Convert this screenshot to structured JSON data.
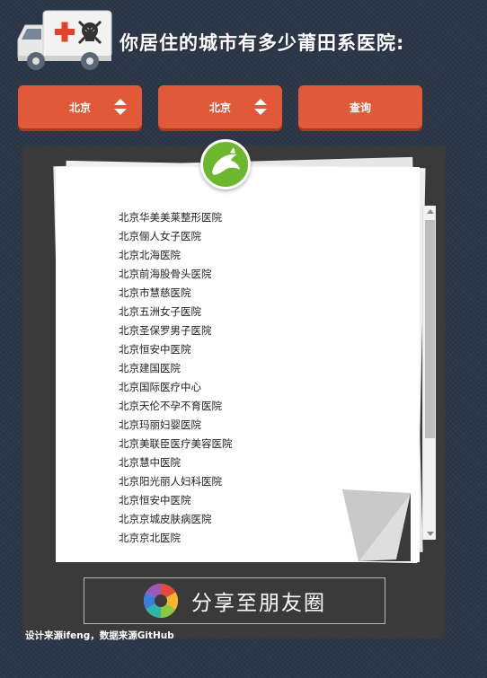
{
  "header": {
    "title": "你居住的城市有多少莆田系医院:",
    "icon": "ambulance-skull-icon"
  },
  "controls": {
    "province_value": "北京",
    "city_value": "北京",
    "query_label": "查询"
  },
  "results": {
    "items": [
      "北京华美美莱整形医院",
      "北京俪人女子医院",
      "北京北海医院",
      "北京前海股骨头医院",
      "北京市慧慈医院",
      "北京五洲女子医院",
      "北京圣保罗男子医院",
      "北京恒安中医院",
      "北京建国医院",
      "北京国际医疗中心",
      "北京天伦不孕不育医院",
      "北京玛丽妇婴医院",
      "北京美联臣医疗美容医院",
      "北京慧中医院",
      "北京阳光丽人妇科医院",
      "北京恒安中医院",
      "北京京城皮肤病医院",
      "北京京北医院"
    ]
  },
  "share": {
    "label": "分享至朋友圈",
    "icon": "camera-aperture-icon"
  },
  "footer": {
    "credits": "设计来源ifeng，数据来源GitHub"
  },
  "colors": {
    "background": "#2b3648",
    "button": "#e05a3a",
    "panel": "#3a3a3a",
    "badge": "#6cb72d"
  }
}
